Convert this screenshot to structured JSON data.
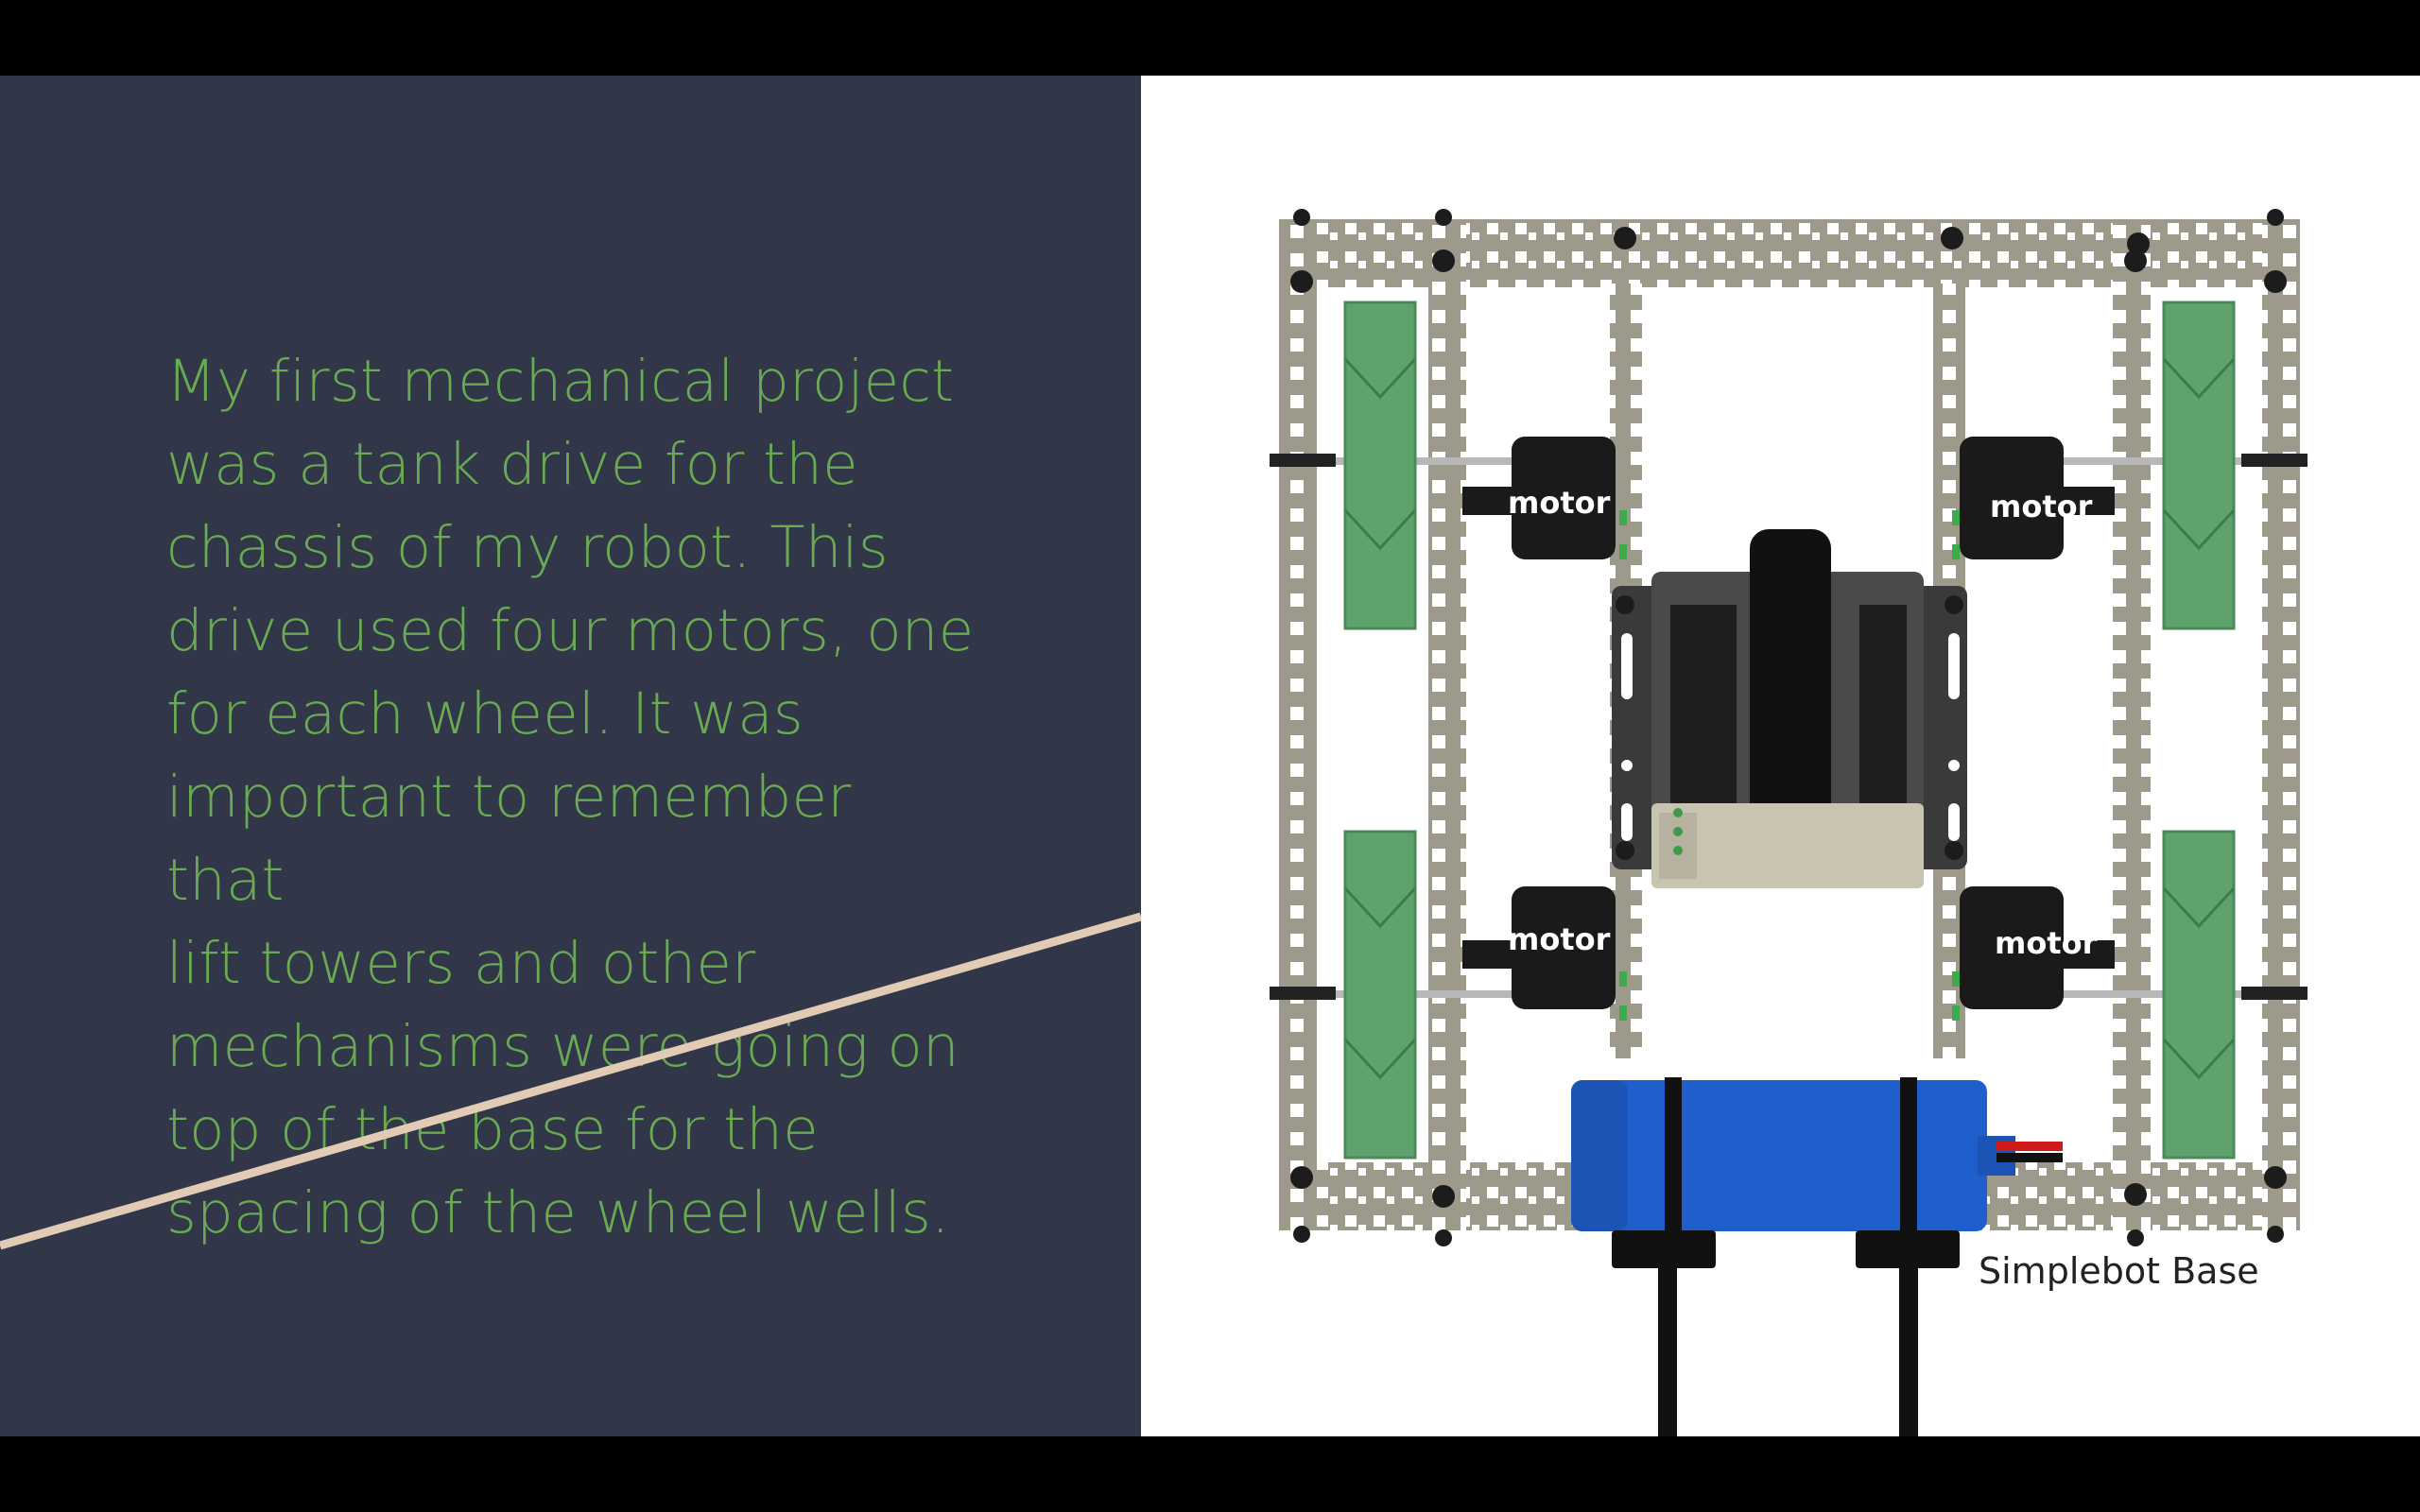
{
  "slide": {
    "body_text": "My first mechanical project\nwas a tank drive for the\nchassis of my robot. This\ndrive used four motors, one\nfor each wheel. It was\nimportant to remember that\nlift towers and other\nmechanisms were going on\ntop of the base for the\nspacing of the wheel wells.",
    "image": {
      "caption": "Simplebot Base",
      "motor_labels": [
        "motor",
        "motor",
        "motor",
        "motor"
      ]
    }
  },
  "colors": {
    "background_left": "#313649",
    "text_green": "#6aaa52",
    "accent_line": "#e1cbb5",
    "letterbox": "#000000"
  }
}
